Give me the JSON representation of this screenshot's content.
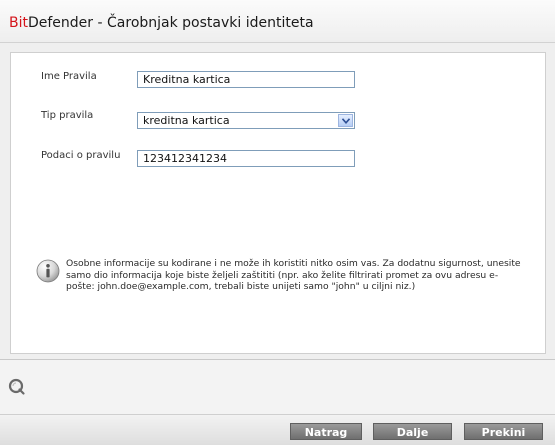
{
  "window": {
    "title_brand_red": "Bit",
    "title_brand_rest": "Defender",
    "title_rest": " - Čarobnjak postavki identiteta"
  },
  "form": {
    "rule_name_label": "Ime Pravila",
    "rule_name_value": "Kreditna kartica",
    "rule_type_label": "Tip pravila",
    "rule_type_value": "kreditna kartica",
    "rule_data_label": "Podaci o pravilu",
    "rule_data_value": "123412341234"
  },
  "info": {
    "text": "Osobne informacije su kodirane i ne može ih koristiti nitko osim vas. Za dodatnu sigurnost, unesite samo dio informacija koje biste željeli zaštititi (npr. ako želite filtrirati promet za ovu adresu e-pošte: john.doe@example.com, trebali biste unijeti samo \"john\" u ciljni niz.)",
    "icon": "info-icon"
  },
  "buttons": {
    "back": "Natrag",
    "next": "Dalje",
    "cancel": "Prekini"
  },
  "colors": {
    "brand_red": "#d4141b",
    "button_gray": "#7f7f7f",
    "input_border": "#7f9db9"
  }
}
